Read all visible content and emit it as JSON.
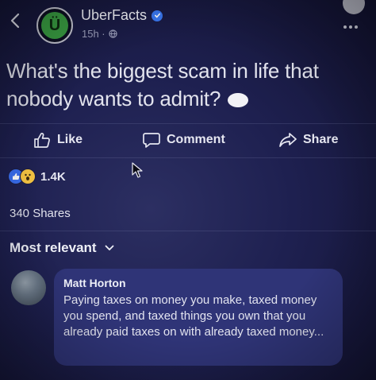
{
  "header": {
    "page_name": "UberFacts",
    "time": "15h ·",
    "avatar_letter": "Ü"
  },
  "post": {
    "text": "What's the biggest scam in life that nobody wants to admit?"
  },
  "actions": {
    "like": "Like",
    "comment": "Comment",
    "share": "Share"
  },
  "reactions": {
    "count": "1.4K"
  },
  "shares": "340 Shares",
  "sort": {
    "label": "Most relevant"
  },
  "comment": {
    "author": "Matt Horton",
    "text": "Paying taxes on money you make, taxed money you spend, and taxed things you own that you already paid taxes on with already taxed money..."
  },
  "colors": {
    "background": "#1e2050",
    "comment_bubble": "#2f3477",
    "verified_badge": "#3a78f2",
    "avatar_green": "#3aa043"
  }
}
